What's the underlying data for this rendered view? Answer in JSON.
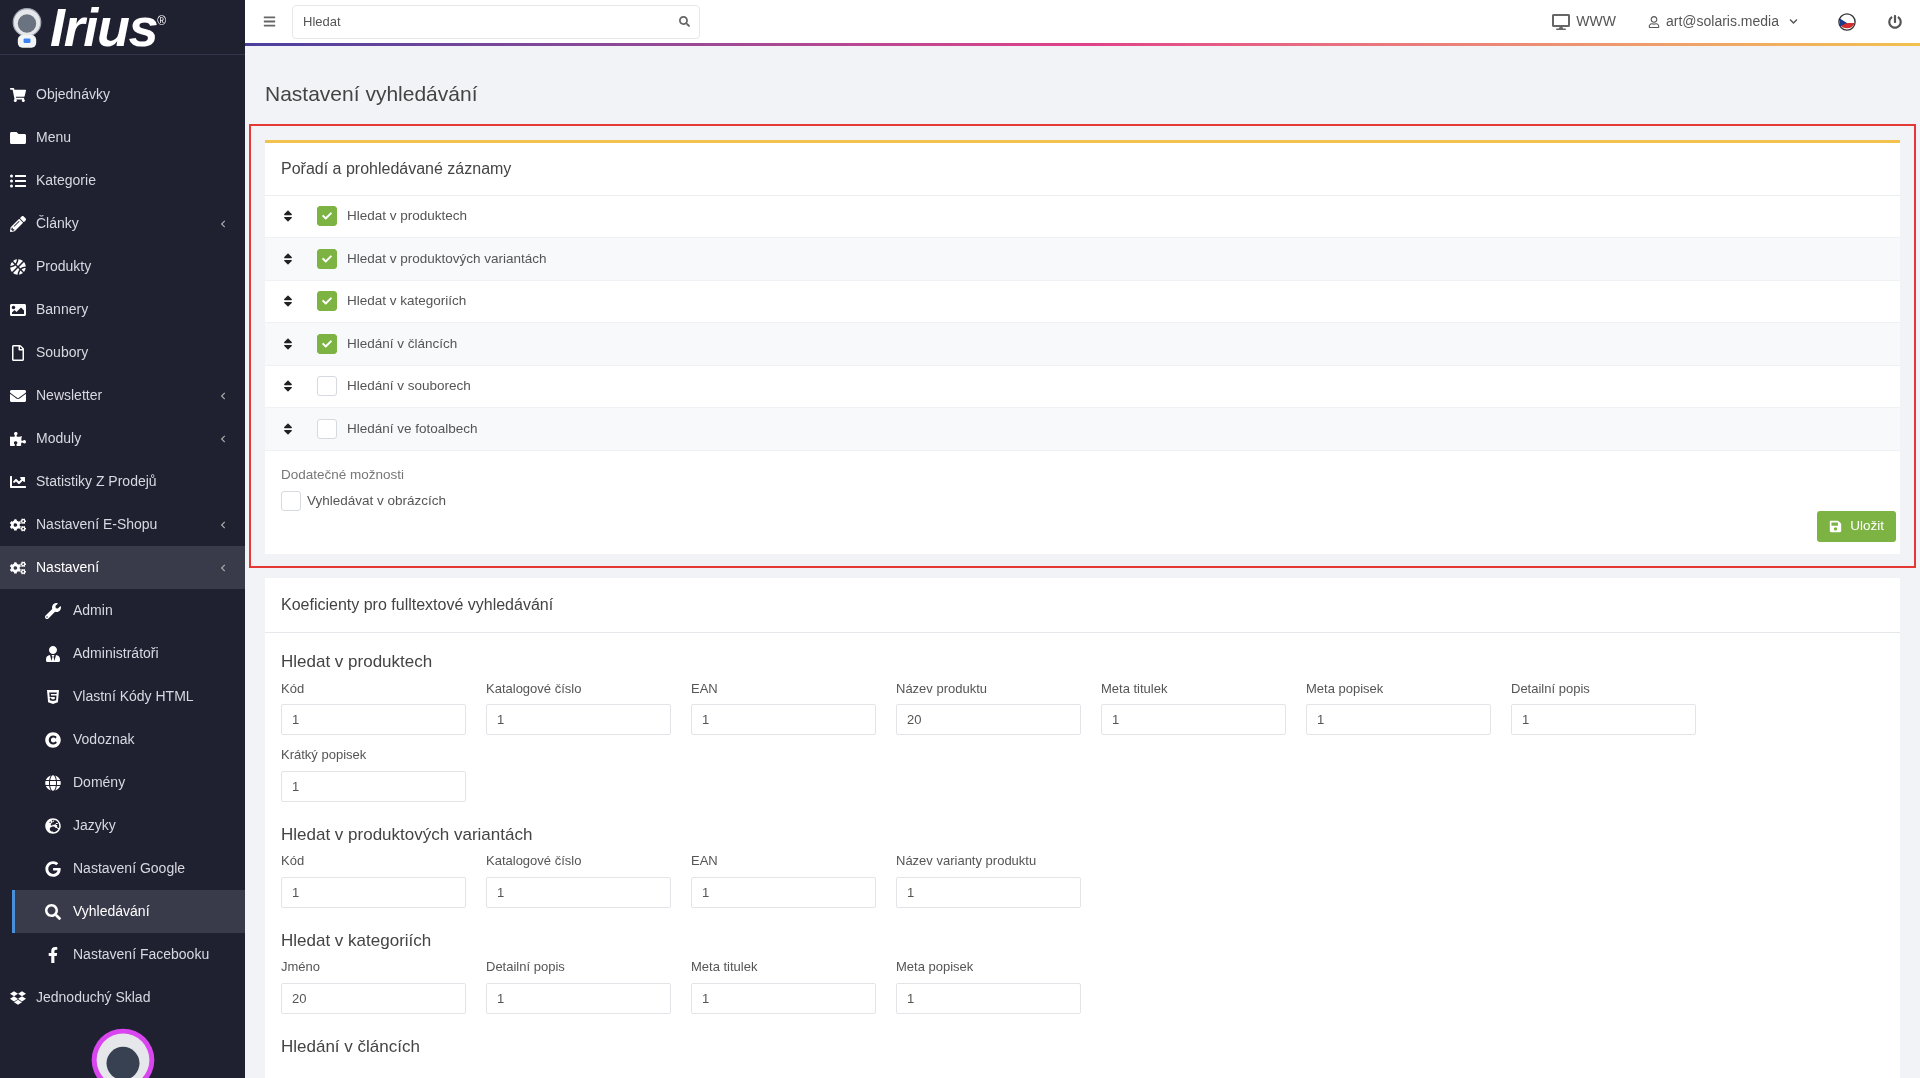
{
  "logo": {
    "text": "Irius",
    "mark": "®"
  },
  "sidebar": {
    "items": [
      {
        "label": "Objednávky",
        "has_submenu": false,
        "selected": false
      },
      {
        "label": "Menu",
        "has_submenu": false,
        "selected": false
      },
      {
        "label": "Kategorie",
        "has_submenu": false,
        "selected": false
      },
      {
        "label": "Články",
        "has_submenu": true,
        "selected": false
      },
      {
        "label": "Produkty",
        "has_submenu": false,
        "selected": false
      },
      {
        "label": "Bannery",
        "has_submenu": false,
        "selected": false
      },
      {
        "label": "Soubory",
        "has_submenu": false,
        "selected": false
      },
      {
        "label": "Newsletter",
        "has_submenu": true,
        "selected": false
      },
      {
        "label": "Moduly",
        "has_submenu": true,
        "selected": false
      },
      {
        "label": "Statistiky Z Prodejů",
        "has_submenu": false,
        "selected": false
      },
      {
        "label": "Nastavení E-Shopu",
        "has_submenu": true,
        "selected": false
      },
      {
        "label": "Nastavení",
        "has_submenu": true,
        "selected": true,
        "children": [
          {
            "label": "Admin",
            "selected": false
          },
          {
            "label": "Administrátoři",
            "selected": false
          },
          {
            "label": "Vlastní Kódy HTML",
            "selected": false
          },
          {
            "label": "Vodoznak",
            "selected": false
          },
          {
            "label": "Domény",
            "selected": false
          },
          {
            "label": "Jazyky",
            "selected": false
          },
          {
            "label": "Nastavení Google",
            "selected": false
          },
          {
            "label": "Vyhledávání",
            "selected": true
          },
          {
            "label": "Nastavení Facebooku",
            "selected": false
          }
        ]
      },
      {
        "label": "Jednoduchý Sklad",
        "has_submenu": false,
        "selected": false
      }
    ]
  },
  "topbar": {
    "search": {
      "placeholder": "Hledat"
    },
    "www_link": "WWW",
    "user": "art@solaris.media"
  },
  "page_title": "Nastavení vyhledávání",
  "order_card": {
    "title": "Pořadí a prohledávané záznamy",
    "rows": [
      {
        "label": "Hledat v produktech",
        "checked": true
      },
      {
        "label": "Hledat v produktových variantách",
        "checked": true
      },
      {
        "label": "Hledat v kategoriích",
        "checked": true
      },
      {
        "label": "Hledání v článcích",
        "checked": true
      },
      {
        "label": "Hledání v souborech",
        "checked": false
      },
      {
        "label": "Hledání ve fotoalbech",
        "checked": false
      }
    ],
    "extra_title": "Dodatečné možnosti",
    "extra_options": [
      {
        "label": "Vyhledávat v obrázcích",
        "checked": false
      }
    ],
    "save_button": "Uložit"
  },
  "coefficients_card": {
    "title": "Koeficienty pro fulltextové vyhledávání",
    "groups": [
      {
        "title": "Hledat v produktech",
        "fields": [
          {
            "label": "Kód",
            "value": "1"
          },
          {
            "label": "Katalogové číslo",
            "value": "1"
          },
          {
            "label": "EAN",
            "value": "1"
          },
          {
            "label": "Název produktu",
            "value": "20"
          },
          {
            "label": "Meta titulek",
            "value": "1"
          },
          {
            "label": "Meta popisek",
            "value": "1"
          },
          {
            "label": "Detailní popis",
            "value": "1"
          },
          {
            "label": "Krátký popisek",
            "value": "1"
          }
        ]
      },
      {
        "title": "Hledat v produktových variantách",
        "fields": [
          {
            "label": "Kód",
            "value": "1"
          },
          {
            "label": "Katalogové číslo",
            "value": "1"
          },
          {
            "label": "EAN",
            "value": "1"
          },
          {
            "label": "Název varianty produktu",
            "value": "1"
          }
        ]
      },
      {
        "title": "Hledat v kategoriích",
        "fields": [
          {
            "label": "Jméno",
            "value": "20"
          },
          {
            "label": "Detailní popis",
            "value": "1"
          },
          {
            "label": "Meta titulek",
            "value": "1"
          },
          {
            "label": "Meta popisek",
            "value": "1"
          }
        ]
      },
      {
        "title": "Hledání v článcích"
      }
    ]
  }
}
